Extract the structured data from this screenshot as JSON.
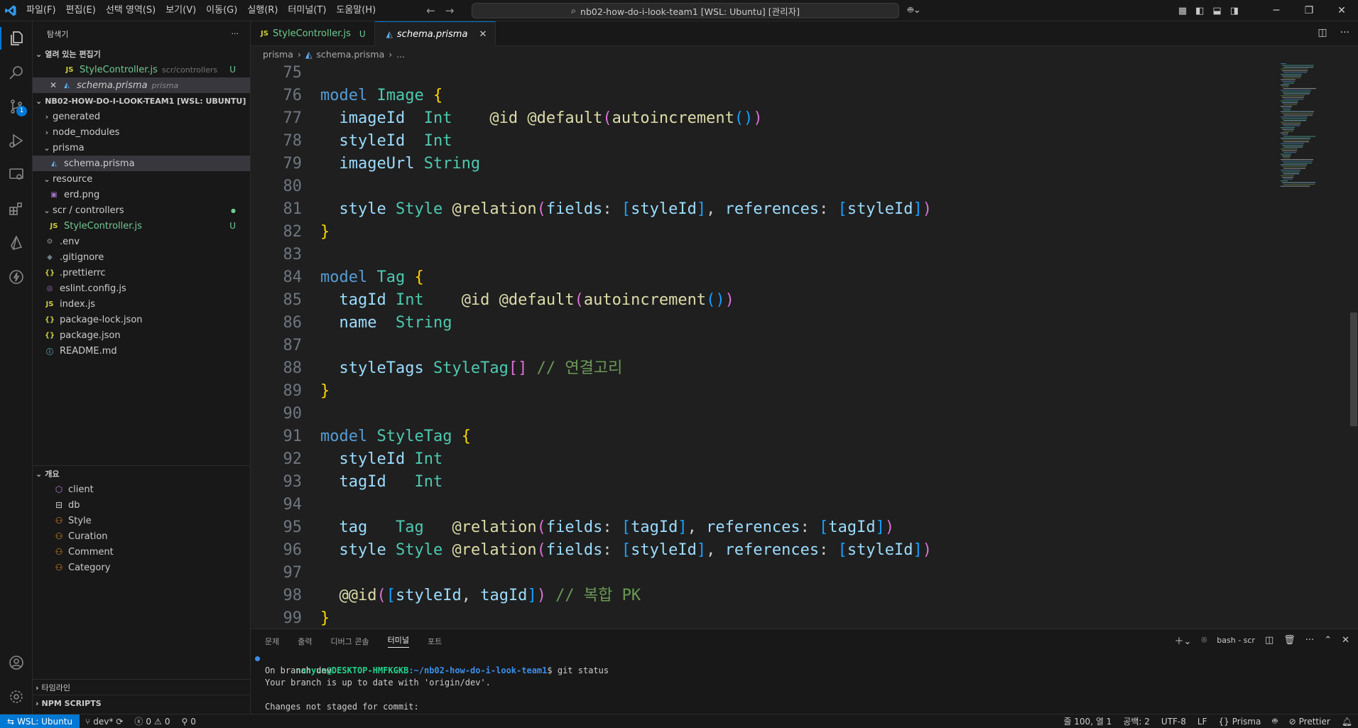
{
  "window": {
    "menus": [
      "파일(F)",
      "편집(E)",
      "선택 영역(S)",
      "보기(V)",
      "이동(G)",
      "실행(R)",
      "터미널(T)",
      "도움말(H)"
    ],
    "command_center": "nb02-how-do-i-look-team1 [WSL: Ubuntu] [관리자]"
  },
  "activity": {
    "scm_badge": "1"
  },
  "sidebar": {
    "title": "탐색기",
    "more": "···",
    "open_editors": {
      "title": "열려 있는 편집기",
      "items": [
        {
          "name": "StyleController.js",
          "desc": "scr/controllers",
          "status": "U",
          "icon": "JS"
        },
        {
          "name": "schema.prisma",
          "desc": "prisma",
          "icon": "prisma"
        }
      ]
    },
    "project": {
      "title": "NB02-HOW-DO-I-LOOK-TEAM1 [WSL: UBUNTU]",
      "items": [
        {
          "name": "generated",
          "type": "folder",
          "open": false,
          "depth": 0
        },
        {
          "name": "node_modules",
          "type": "folder",
          "open": false,
          "depth": 0
        },
        {
          "name": "prisma",
          "type": "folder",
          "open": true,
          "depth": 0
        },
        {
          "name": "schema.prisma",
          "type": "file",
          "icon": "◭",
          "depth": 1
        },
        {
          "name": "resource",
          "type": "folder",
          "open": true,
          "depth": 0
        },
        {
          "name": "erd.png",
          "type": "file",
          "icon": "▣",
          "depth": 1
        },
        {
          "name": "scr / controllers",
          "type": "folder",
          "open": true,
          "depth": 0
        },
        {
          "name": "StyleController.js",
          "type": "file",
          "icon": "JS",
          "depth": 1,
          "status": "U"
        },
        {
          "name": ".env",
          "type": "file",
          "icon": "⚙",
          "depth": 0
        },
        {
          "name": ".gitignore",
          "type": "file",
          "icon": "◆",
          "depth": 0
        },
        {
          "name": ".prettierrc",
          "type": "file",
          "icon": "{}",
          "depth": 0
        },
        {
          "name": "eslint.config.js",
          "type": "file",
          "icon": "◎",
          "depth": 0
        },
        {
          "name": "index.js",
          "type": "file",
          "icon": "JS",
          "depth": 0
        },
        {
          "name": "package-lock.json",
          "type": "file",
          "icon": "{}",
          "depth": 0
        },
        {
          "name": "package.json",
          "type": "file",
          "icon": "{}",
          "depth": 0
        },
        {
          "name": "README.md",
          "type": "file",
          "icon": "ⓘ",
          "depth": 0
        }
      ]
    },
    "outline": {
      "title": "개요",
      "items": [
        {
          "name": "client",
          "icon": "mod"
        },
        {
          "name": "db",
          "icon": "db"
        },
        {
          "name": "Style",
          "icon": "struct"
        },
        {
          "name": "Curation",
          "icon": "struct"
        },
        {
          "name": "Comment",
          "icon": "struct"
        },
        {
          "name": "Category",
          "icon": "struct"
        }
      ]
    },
    "timeline_title": "타임라인",
    "npm_title": "NPM SCRIPTS"
  },
  "editor": {
    "tabs": [
      {
        "label": "StyleController.js",
        "status": "U"
      },
      {
        "label": "schema.prisma",
        "close": "✕"
      }
    ],
    "breadcrumb": [
      "prisma",
      "schema.prisma",
      "..."
    ],
    "lines": [
      {
        "n": "75",
        "c": ""
      },
      {
        "n": "76",
        "c": ""
      },
      {
        "n": "77",
        "c": ""
      },
      {
        "n": "78",
        "c": ""
      },
      {
        "n": "79",
        "c": ""
      },
      {
        "n": "80",
        "c": ""
      },
      {
        "n": "81",
        "c": ""
      },
      {
        "n": "82",
        "c": ""
      },
      {
        "n": "83",
        "c": ""
      },
      {
        "n": "84",
        "c": ""
      },
      {
        "n": "85",
        "c": ""
      },
      {
        "n": "86",
        "c": ""
      },
      {
        "n": "87",
        "c": ""
      },
      {
        "n": "88",
        "c": ""
      },
      {
        "n": "89",
        "c": ""
      },
      {
        "n": "90",
        "c": ""
      },
      {
        "n": "91",
        "c": ""
      },
      {
        "n": "92",
        "c": ""
      },
      {
        "n": "93",
        "c": ""
      },
      {
        "n": "94",
        "c": ""
      },
      {
        "n": "95",
        "c": ""
      },
      {
        "n": "96",
        "c": ""
      },
      {
        "n": "97",
        "c": ""
      },
      {
        "n": "98",
        "c": ""
      },
      {
        "n": "99",
        "c": ""
      }
    ],
    "code_tokens": [
      [],
      [
        [
          "kw",
          "model "
        ],
        [
          "ty",
          "Image "
        ],
        [
          "br1",
          "{"
        ]
      ],
      [
        [
          "fld",
          "  imageId  "
        ],
        [
          "ty",
          "Int    "
        ],
        [
          "attr",
          "@id @default"
        ],
        [
          "br2",
          "("
        ],
        [
          "attr",
          "autoincrement"
        ],
        [
          "br3",
          "()"
        ],
        [
          "br2",
          ")"
        ]
      ],
      [
        [
          "fld",
          "  styleId  "
        ],
        [
          "ty",
          "Int"
        ]
      ],
      [
        [
          "fld",
          "  imageUrl "
        ],
        [
          "ty",
          "String"
        ]
      ],
      [],
      [
        [
          "fld",
          "  style "
        ],
        [
          "ty",
          "Style "
        ],
        [
          "attr",
          "@relation"
        ],
        [
          "br2",
          "("
        ],
        [
          "fld",
          "fields"
        ],
        [
          "plain",
          ": "
        ],
        [
          "br3",
          "["
        ],
        [
          "fld",
          "styleId"
        ],
        [
          "br3",
          "]"
        ],
        [
          "plain",
          ", "
        ],
        [
          "fld",
          "references"
        ],
        [
          "plain",
          ": "
        ],
        [
          "br3",
          "["
        ],
        [
          "fld",
          "styleId"
        ],
        [
          "br3",
          "]"
        ],
        [
          "br2",
          ")"
        ]
      ],
      [
        [
          "br1",
          "}"
        ]
      ],
      [],
      [
        [
          "kw",
          "model "
        ],
        [
          "ty",
          "Tag "
        ],
        [
          "br1",
          "{"
        ]
      ],
      [
        [
          "fld",
          "  tagId "
        ],
        [
          "ty",
          "Int    "
        ],
        [
          "attr",
          "@id @default"
        ],
        [
          "br2",
          "("
        ],
        [
          "attr",
          "autoincrement"
        ],
        [
          "br3",
          "()"
        ],
        [
          "br2",
          ")"
        ]
      ],
      [
        [
          "fld",
          "  name  "
        ],
        [
          "ty",
          "String"
        ]
      ],
      [],
      [
        [
          "fld",
          "  styleTags "
        ],
        [
          "ty",
          "StyleTag"
        ],
        [
          "br2",
          "[]"
        ],
        [
          "cm",
          " // 연결고리"
        ]
      ],
      [
        [
          "br1",
          "}"
        ]
      ],
      [],
      [
        [
          "kw",
          "model "
        ],
        [
          "ty",
          "StyleTag "
        ],
        [
          "br1",
          "{"
        ]
      ],
      [
        [
          "fld",
          "  styleId "
        ],
        [
          "ty",
          "Int"
        ]
      ],
      [
        [
          "fld",
          "  tagId   "
        ],
        [
          "ty",
          "Int"
        ]
      ],
      [],
      [
        [
          "fld",
          "  tag   "
        ],
        [
          "ty",
          "Tag   "
        ],
        [
          "attr",
          "@relation"
        ],
        [
          "br2",
          "("
        ],
        [
          "fld",
          "fields"
        ],
        [
          "plain",
          ": "
        ],
        [
          "br3",
          "["
        ],
        [
          "fld",
          "tagId"
        ],
        [
          "br3",
          "]"
        ],
        [
          "plain",
          ", "
        ],
        [
          "fld",
          "references"
        ],
        [
          "plain",
          ": "
        ],
        [
          "br3",
          "["
        ],
        [
          "fld",
          "tagId"
        ],
        [
          "br3",
          "]"
        ],
        [
          "br2",
          ")"
        ]
      ],
      [
        [
          "fld",
          "  style "
        ],
        [
          "ty",
          "Style "
        ],
        [
          "attr",
          "@relation"
        ],
        [
          "br2",
          "("
        ],
        [
          "fld",
          "fields"
        ],
        [
          "plain",
          ": "
        ],
        [
          "br3",
          "["
        ],
        [
          "fld",
          "styleId"
        ],
        [
          "br3",
          "]"
        ],
        [
          "plain",
          ", "
        ],
        [
          "fld",
          "references"
        ],
        [
          "plain",
          ": "
        ],
        [
          "br3",
          "["
        ],
        [
          "fld",
          "styleId"
        ],
        [
          "br3",
          "]"
        ],
        [
          "br2",
          ")"
        ]
      ],
      [],
      [
        [
          "attr",
          "  @@id"
        ],
        [
          "br2",
          "("
        ],
        [
          "br3",
          "["
        ],
        [
          "fld",
          "styleId"
        ],
        [
          "plain",
          ", "
        ],
        [
          "fld",
          "tagId"
        ],
        [
          "br3",
          "]"
        ],
        [
          "br2",
          ")"
        ],
        [
          "cm",
          " // 복합 PK"
        ]
      ],
      [
        [
          "br1",
          "}"
        ]
      ]
    ]
  },
  "panel": {
    "tabs": [
      "문제",
      "출력",
      "디버그 콘솔",
      "터미널",
      "포트"
    ],
    "active_tab": "터미널",
    "terminal_name": "bash - scr",
    "prompt_user": "nahyun@DESKTOP-HMFKGKB",
    "prompt_path": ":~/nb02-how-do-i-look-team1",
    "prompt_cmd": "$ git status",
    "output": [
      "On branch dev",
      "Your branch is up to date with 'origin/dev'.",
      "",
      "Changes not staged for commit:"
    ]
  },
  "statusbar": {
    "remote": "WSL: Ubuntu",
    "branch": "dev*",
    "errors": "0",
    "warnings": "0",
    "ports": "0",
    "position": "줄 100, 열 1",
    "spaces": "공백: 2",
    "encoding": "UTF-8",
    "eol": "LF",
    "language": "Prisma",
    "formatter": "Prettier"
  },
  "colors": {
    "accent": "#0078d4",
    "untracked": "#73c991"
  }
}
